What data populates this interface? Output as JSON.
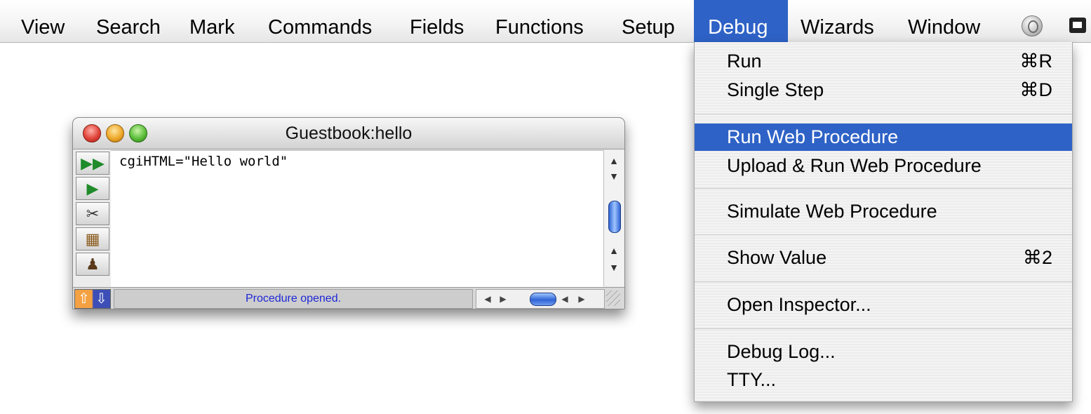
{
  "menubar": {
    "items": [
      "View",
      "Search",
      "Mark",
      "Commands",
      "Fields",
      "Functions",
      "Setup",
      "Debug",
      "Wizards",
      "Window"
    ],
    "active": "Debug",
    "icons": [
      "globe-icon",
      "window-icon"
    ]
  },
  "window": {
    "title": "Guestbook:hello",
    "code": "cgiHTML=\"Hello world\"",
    "status": "Procedure opened.",
    "tools": [
      "fast-forward-icon",
      "play-icon",
      "scissors-icon",
      "puzzle-icon",
      "user-icon"
    ]
  },
  "debug_menu": {
    "items": [
      {
        "label": "Run",
        "shortcut": "⌘R"
      },
      {
        "label": "Single Step",
        "shortcut": "⌘D"
      },
      {
        "label": "Run Web Procedure",
        "shortcut": "",
        "selected": true
      },
      {
        "label": "Upload & Run Web Procedure",
        "shortcut": ""
      },
      {
        "label": "Simulate Web Procedure",
        "shortcut": ""
      },
      {
        "label": "Show Value",
        "shortcut": "⌘2"
      },
      {
        "label": "Open Inspector...",
        "shortcut": ""
      },
      {
        "label": "Debug Log...",
        "shortcut": ""
      },
      {
        "label": "TTY...",
        "shortcut": ""
      }
    ]
  },
  "colors": {
    "highlight": "#2e62c6",
    "status_text": "#1d27d6"
  }
}
